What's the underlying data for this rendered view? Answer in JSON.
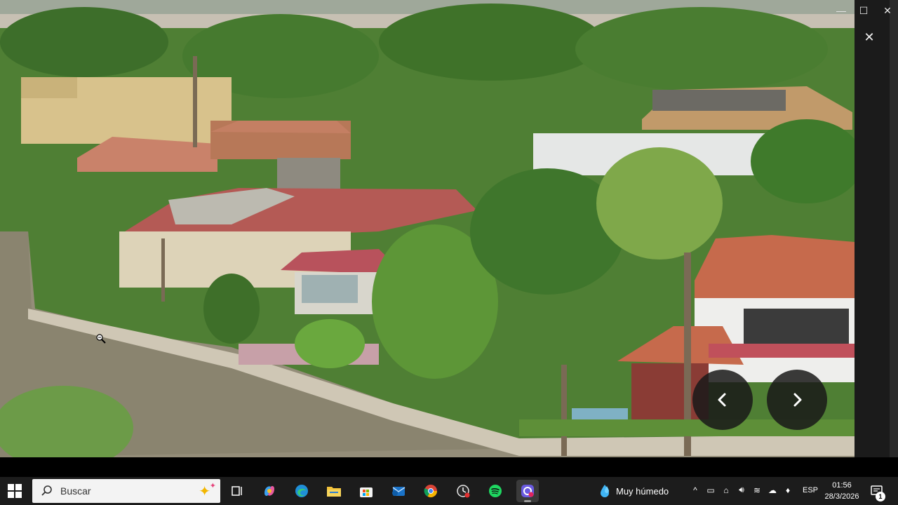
{
  "viewer": {
    "prev_label": "‹",
    "next_label": "›",
    "close_glyph": "✕",
    "minimize_glyph": "—",
    "maximize_glyph": "☐"
  },
  "taskbar": {
    "search_placeholder": "Buscar",
    "apps": [
      {
        "name": "task-view",
        "icon": "task-view-icon"
      },
      {
        "name": "copilot",
        "icon": "copilot-icon"
      },
      {
        "name": "edge",
        "icon": "edge-icon"
      },
      {
        "name": "file-explorer",
        "icon": "folder-icon"
      },
      {
        "name": "store",
        "icon": "store-icon"
      },
      {
        "name": "outlook",
        "icon": "mail-icon"
      },
      {
        "name": "chrome",
        "icon": "chrome-icon"
      },
      {
        "name": "clock-app",
        "icon": "clock-icon"
      },
      {
        "name": "spotify",
        "icon": "spotify-icon"
      },
      {
        "name": "photos",
        "icon": "photos-icon",
        "active": true
      }
    ],
    "weather": "Muy húmedo",
    "language": "ESP",
    "time": "01:56",
    "date": "28/3/2026",
    "notification_count": "1"
  },
  "colors": {
    "taskbar_bg": "#1c1c1c",
    "nav_button_bg": "#191919",
    "search_bg": "#f3f3f3"
  }
}
